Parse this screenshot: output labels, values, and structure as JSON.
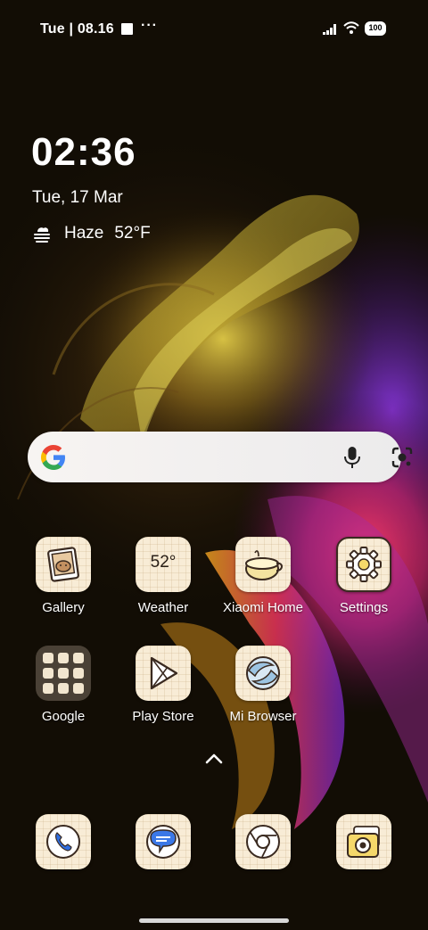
{
  "status_bar": {
    "time": "Tue | 08.16",
    "dots": "···",
    "battery": "100"
  },
  "clock_widget": {
    "time": "02:36",
    "date": "Tue, 17 Mar",
    "condition": "Haze",
    "temperature": "52°F"
  },
  "search_bar": {
    "logo": "google-g-icon",
    "mic": "microphone-icon",
    "lens": "camera-lens-icon"
  },
  "apps_row1": [
    {
      "label": "Gallery",
      "icon": "gallery-icon"
    },
    {
      "label": "Weather",
      "icon": "weather-icon",
      "tile_text": "52°"
    },
    {
      "label": "Xiaomi Home",
      "icon": "xiaomi-home-icon"
    },
    {
      "label": "Settings",
      "icon": "settings-gear-icon"
    }
  ],
  "apps_row2": [
    {
      "label": "Google",
      "icon": "google-folder-icon"
    },
    {
      "label": "Play Store",
      "icon": "play-store-icon"
    },
    {
      "label": "Mi Browser",
      "icon": "mi-browser-icon"
    }
  ],
  "dock": [
    {
      "icon": "phone-icon"
    },
    {
      "icon": "messages-icon"
    },
    {
      "icon": "chrome-icon"
    },
    {
      "icon": "camera-icon"
    }
  ],
  "colors": {
    "tile_bg": "#f8ecd6",
    "wallpaper_base": "#120d05",
    "glow_yellow": "#d8c23a",
    "glow_magenta": "#e0306a",
    "glow_purple": "#7a2fd0"
  }
}
